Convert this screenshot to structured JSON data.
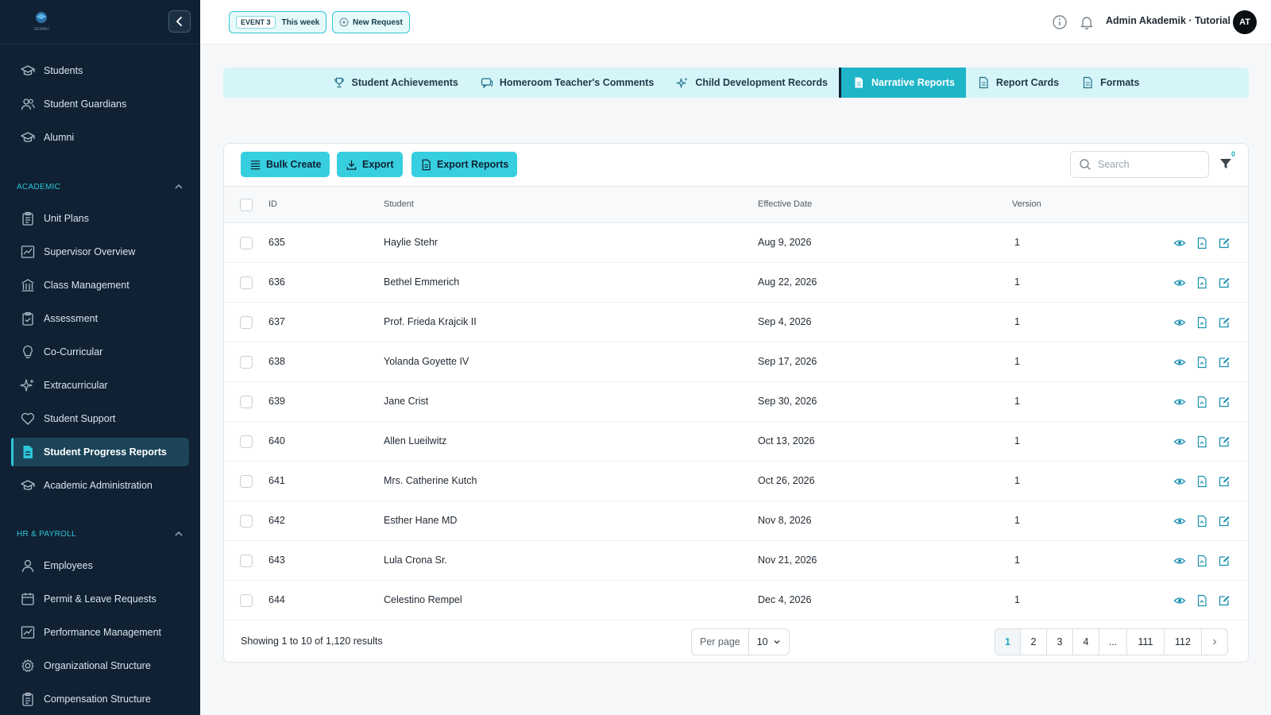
{
  "sidebar": {
    "brand": "GEMAKI",
    "top_items": [
      {
        "label": "Students",
        "icon": "graduation-cap-icon"
      },
      {
        "label": "Student Guardians",
        "icon": "users-icon"
      },
      {
        "label": "Alumni",
        "icon": "graduation-cap-icon"
      }
    ],
    "academic_title": "ACADEMIC",
    "academic_items": [
      {
        "label": "Unit Plans",
        "icon": "clipboard-icon"
      },
      {
        "label": "Supervisor Overview",
        "icon": "chart-icon"
      },
      {
        "label": "Class Management",
        "icon": "building-icon"
      },
      {
        "label": "Assessment",
        "icon": "clipboard-check-icon"
      },
      {
        "label": "Co-Curricular",
        "icon": "lightbulb-icon"
      },
      {
        "label": "Extracurricular",
        "icon": "sparkles-icon"
      },
      {
        "label": "Student Support",
        "icon": "heart-icon"
      },
      {
        "label": "Student Progress Reports",
        "icon": "document-icon",
        "active": true
      },
      {
        "label": "Academic Administration",
        "icon": "graduation-cap-icon"
      }
    ],
    "hr_title": "HR & PAYROLL",
    "hr_items": [
      {
        "label": "Employees",
        "icon": "user-icon"
      },
      {
        "label": "Permit & Leave Requests",
        "icon": "calendar-icon"
      },
      {
        "label": "Performance Management",
        "icon": "chart-icon"
      },
      {
        "label": "Organizational Structure",
        "icon": "gear-icon"
      },
      {
        "label": "Compensation Structure",
        "icon": "clipboard-icon"
      }
    ]
  },
  "topbar": {
    "event_tag": "EVENT 3",
    "event_label": "This week",
    "new_request_label": "New Request",
    "user_name": "Admin Akademik · Tutorial",
    "avatar_initials": "AT"
  },
  "tabs": [
    {
      "label": "Student Achievements",
      "icon": "trophy-icon"
    },
    {
      "label": "Homeroom Teacher's Comments",
      "icon": "chat-icon"
    },
    {
      "label": "Child Development Records",
      "icon": "sparkles-icon"
    },
    {
      "label": "Narrative Reports",
      "icon": "document-icon",
      "active": true
    },
    {
      "label": "Report Cards",
      "icon": "document-icon"
    },
    {
      "label": "Formats",
      "icon": "document-icon"
    }
  ],
  "toolbar": {
    "bulk_create_label": "Bulk Create",
    "export_label": "Export",
    "export_reports_label": "Export Reports",
    "search_placeholder": "Search",
    "filter_count": "0"
  },
  "table": {
    "columns": [
      "ID",
      "Student",
      "Effective Date",
      "Version"
    ],
    "rows": [
      {
        "id": "635",
        "student": "Haylie Stehr",
        "date": "Aug 9, 2026",
        "version": "1"
      },
      {
        "id": "636",
        "student": "Bethel Emmerich",
        "date": "Aug 22, 2026",
        "version": "1"
      },
      {
        "id": "637",
        "student": "Prof. Frieda Krajcik II",
        "date": "Sep 4, 2026",
        "version": "1"
      },
      {
        "id": "638",
        "student": "Yolanda Goyette IV",
        "date": "Sep 17, 2026",
        "version": "1"
      },
      {
        "id": "639",
        "student": "Jane Crist",
        "date": "Sep 30, 2026",
        "version": "1"
      },
      {
        "id": "640",
        "student": "Allen Lueilwitz",
        "date": "Oct 13, 2026",
        "version": "1"
      },
      {
        "id": "641",
        "student": "Mrs. Catherine Kutch",
        "date": "Oct 26, 2026",
        "version": "1"
      },
      {
        "id": "642",
        "student": "Esther Hane MD",
        "date": "Nov 8, 2026",
        "version": "1"
      },
      {
        "id": "643",
        "student": "Lula Crona Sr.",
        "date": "Nov 21, 2026",
        "version": "1"
      },
      {
        "id": "644",
        "student": "Celestino Rempel",
        "date": "Dec 4, 2026",
        "version": "1"
      }
    ]
  },
  "footer": {
    "showing_text": "Showing 1 to 10 of 1,120 results",
    "per_page_label": "Per page",
    "per_page_value": "10",
    "pages": [
      "1",
      "2",
      "3",
      "4",
      "...",
      "111",
      "112"
    ],
    "current_page": "1"
  },
  "colors": {
    "sidebar_bg": "#0f2133",
    "accent": "#2ec5d8",
    "button": "#37cfe0",
    "tab_bar": "#d5f5f8",
    "active_tab": "#1fb5c9",
    "action_icon": "#1a8fb0"
  }
}
